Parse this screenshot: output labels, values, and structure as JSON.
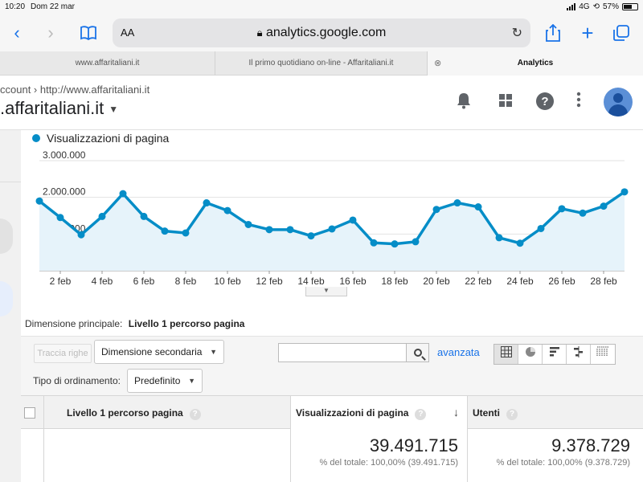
{
  "status_bar": {
    "time": "10:20",
    "date": "Dom 22 mar",
    "network": "4G",
    "battery": "57%"
  },
  "browser": {
    "text_size_label": "AA",
    "url": "analytics.google.com",
    "tabs": [
      {
        "label": "www.affaritaliani.it"
      },
      {
        "label": "Il primo quotidiano on-line - Affaritaliani.it"
      },
      {
        "label": "Analytics"
      }
    ]
  },
  "ga_header": {
    "breadcrumb": "ccount  ›  http://www.affaritaliani.it",
    "property": ".affaritaliani.it"
  },
  "chart_data": {
    "type": "line",
    "series": [
      {
        "name": "Visualizzazioni di pagina",
        "values": [
          1900000,
          1450000,
          980000,
          1480000,
          2100000,
          1480000,
          1080000,
          1030000,
          1850000,
          1640000,
          1260000,
          1120000,
          1120000,
          950000,
          1140000,
          1380000,
          760000,
          730000,
          790000,
          1670000,
          1850000,
          1740000,
          900000,
          750000,
          1150000,
          1690000,
          1570000,
          1760000,
          2150000
        ]
      }
    ],
    "x_dates": [
      "1 feb",
      "2 feb",
      "3 feb",
      "4 feb",
      "5 feb",
      "6 feb",
      "7 feb",
      "8 feb",
      "9 feb",
      "10 feb",
      "11 feb",
      "12 feb",
      "13 feb",
      "14 feb",
      "15 feb",
      "16 feb",
      "17 feb",
      "18 feb",
      "19 feb",
      "20 feb",
      "21 feb",
      "22 feb",
      "23 feb",
      "24 feb",
      "25 feb",
      "26 feb",
      "27 feb",
      "28 feb",
      "29 feb"
    ],
    "x_tick_labels": [
      "2 feb",
      "4 feb",
      "6 feb",
      "8 feb",
      "10 feb",
      "12 feb",
      "14 feb",
      "16 feb",
      "18 feb",
      "20 feb",
      "22 feb",
      "24 feb",
      "26 feb",
      "28 feb"
    ],
    "y_tick_labels": [
      "3.000.000",
      "2.000.000",
      "1.000.000"
    ],
    "y_ticks": [
      3000000,
      2000000,
      1000000
    ],
    "ylim": [
      0,
      3000000
    ],
    "grid": true,
    "color": "#058dc7",
    "fill_color": "#e6f3fa"
  },
  "report": {
    "dimension_label": "Dimensione principale:",
    "dimension_value": "Livello 1 percorso pagina",
    "traccia_button": "Traccia righe",
    "secondary_dimension": "Dimensione secondaria",
    "search_placeholder": "",
    "advanced_link": "avanzata",
    "sort_label": "Tipo di ordinamento:",
    "sort_value": "Predefinito",
    "view_icons": [
      "table-view-icon",
      "pie-view-icon",
      "performance-view-icon",
      "comparison-view-icon",
      "pivot-view-icon"
    ]
  },
  "table": {
    "headers": [
      "Livello 1 percorso pagina",
      "Visualizzazioni di pagina",
      "Utenti"
    ],
    "totals": [
      {
        "value": "39.491.715",
        "percent": "% del totale: 100,00% (39.491.715)"
      },
      {
        "value": "9.378.729",
        "percent": "% del totale: 100,00% (9.378.729)"
      }
    ]
  }
}
